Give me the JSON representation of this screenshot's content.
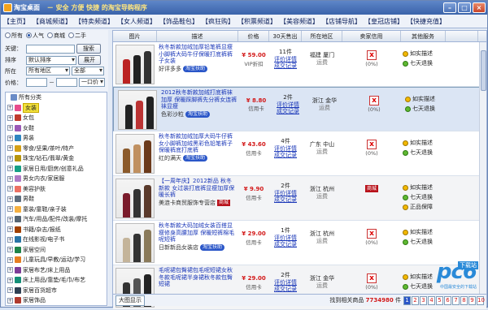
{
  "window": {
    "title": "淘宝桌面",
    "subtitle": "－ 安全 方便 快捷 的淘宝导购程序"
  },
  "menu": [
    "【主页】",
    "【商城频道】",
    "【特卖频道】",
    "【女人频道】",
    "【饰品鞋包】",
    "【疯狂购】",
    "【积票频道】",
    "【美容频道】",
    "【店铺导航】",
    "【皇冠店铺】",
    "【快捷充值】"
  ],
  "filters": {
    "type_options": [
      "所有",
      "人气",
      "商城",
      "二手"
    ],
    "type_selected": 1,
    "keyword_label": "关键：",
    "keyword_value": "",
    "search_button": "搜索",
    "sort_label": "排序",
    "sort_value": "默认排序",
    "expand_button": "展开",
    "region_label": "所在",
    "region_value": "所有地区",
    "region2_value": "全部",
    "price_label": "价格：",
    "price_sep": "－",
    "price_unit": "一口价"
  },
  "tree": {
    "root": "所有分类",
    "items": [
      {
        "label": "女装",
        "selected": true,
        "color": "#e74c8b"
      },
      {
        "label": "女包",
        "color": "#c0392b"
      },
      {
        "label": "女鞋",
        "color": "#9b59b6"
      },
      {
        "label": "男装",
        "color": "#2e86c1"
      },
      {
        "label": "零食/坚果/茶叶/特产",
        "color": "#d4a017"
      },
      {
        "label": "珠宝/钻石/翡翠/黄金",
        "color": "#b7950b"
      },
      {
        "label": "家居日用/厨房/创意礼品",
        "color": "#16a085"
      },
      {
        "label": "男女内衣/家居服",
        "color": "#af7ac5"
      },
      {
        "label": "美容护肤",
        "color": "#ec7063"
      },
      {
        "label": "男鞋",
        "color": "#5d6d7e"
      },
      {
        "label": "童装/童鞋/亲子装",
        "color": "#f5b041"
      },
      {
        "label": "汽车/用品/配件/改装/摩托",
        "color": "#566573"
      },
      {
        "label": "书籍/杂志/报纸",
        "color": "#a04000"
      },
      {
        "label": "在线影视/电子书",
        "color": "#2874a6"
      },
      {
        "label": "家居空间",
        "color": "#1e8449"
      },
      {
        "label": "儿童玩具/早教/运动/学习",
        "color": "#e67e22"
      },
      {
        "label": "家居布艺/床上用品",
        "color": "#7d3c98"
      },
      {
        "label": "床上用品/靠垫/毛巾/布艺",
        "color": "#148f77"
      },
      {
        "label": "家居百货超市",
        "color": "#2e4053"
      },
      {
        "label": "家居饰品",
        "color": "#b03a2e"
      }
    ]
  },
  "table": {
    "headers": [
      "图片",
      "描述",
      "价格",
      "30天售出",
      "所在地区",
      "卖家信用",
      "其他服务"
    ],
    "rows": [
      {
        "desc": "秋冬新款加绒加厚铅笔裤显瘦小脚裤大码牛仔保暖打底裤裤子女装",
        "seller": "好评多多",
        "coupon": "淘宝扶助",
        "price": "¥ 59.00",
        "pay": "VIP折扣",
        "sales": "11件",
        "review": "评价详情",
        "record": "成交记录",
        "province": "福建",
        "city": "厦门",
        "fee": "运费",
        "credit": "x",
        "pct": "(0%)",
        "svc1": "如实描述",
        "svc2": "七天退换",
        "colors": [
          "#b22",
          "#222",
          "#333"
        ]
      },
      {
        "desc": "2012秋冬新款加绒打底裤袜 加厚 保暖踩脚裤先分裤女连裤袜显瘦",
        "seller": "色彩沙粒",
        "coupon": "淘宝扶助",
        "price": "¥ 8.80",
        "pay": "信用卡",
        "sales": "2件",
        "review": "评价详情",
        "record": "成交记录",
        "province": "浙江",
        "city": "金华",
        "fee": "运费",
        "credit": "x",
        "pct": "(0%)",
        "svc1": "如实描述",
        "svc2": "七天退换",
        "colors": [
          "#222",
          "#b33",
          "#222"
        ]
      },
      {
        "desc": "秋冬新款加绒加厚大码牛仔裤女小脚裤加绒黑彩色铅笔裤子保暖裤底打底裤",
        "seller": "红的满天",
        "coupon": "淘宝扶助",
        "price": "¥ 43.60",
        "pay": "信用卡",
        "sales": "4件",
        "review": "评价详情",
        "record": "成交记录",
        "province": "广东",
        "city": "中山",
        "fee": "运费",
        "credit": "x",
        "pct": "(0%)",
        "svc1": "如实描述",
        "svc2": "七天退换",
        "colors": [
          "#8b5a2b",
          "#c09060",
          "#6b3a1b"
        ]
      },
      {
        "desc": "【一周年庆】2012新品 秋冬新款 女过装打底裤显瘦加厚保暖长裤",
        "seller": "美涟卡商贸服饰专营店",
        "coupon": "商城",
        "price": "¥ 9.90",
        "pay": "信用卡",
        "sales": "2件",
        "review": "评价详情",
        "record": "成交记录",
        "province": "浙江",
        "city": "杭州",
        "fee": "运费",
        "credit": "商城",
        "pct": "",
        "svc1": "如实描述",
        "svc2": "七天退换",
        "svc3": "正品保障",
        "colors": [
          "#7a1b2b",
          "#333",
          "#5a3a2b"
        ]
      },
      {
        "desc": "秋冬新款大码加绒女装百搭显瘦修身高腰加厚 保暖短裤棉毛呢短裤",
        "seller": "日新新品女装店",
        "coupon": "淘宝扶助",
        "price": "¥ 29.00",
        "pay": "信用卡",
        "sales": "1件",
        "review": "评价详情",
        "record": "成交记录",
        "province": "浙江",
        "city": "杭州",
        "fee": "运费",
        "credit": "x",
        "pct": "(0%)",
        "svc1": "如实描述",
        "svc2": "七天退换",
        "colors": [
          "#c4b49a",
          "#333",
          "#8a7a5a"
        ]
      },
      {
        "desc": "毛呢裙包臀裙包毛呢短裙女秋冬款毛呢裙半身裙秋冬款包臀短裙",
        "seller": "",
        "coupon": "",
        "price": "¥ 29.00",
        "pay": "信用卡",
        "sales": "2件",
        "review": "评价详情",
        "record": "成交记录",
        "province": "浙江",
        "city": "金华",
        "fee": "运费",
        "credit": "x",
        "pct": "(0%)",
        "svc1": "如实描述",
        "svc2": "七天退换",
        "colors": [
          "#333",
          "#555",
          "#222"
        ]
      }
    ]
  },
  "footer": {
    "big_image": "大图显示",
    "found_prefix": "找到相关商品",
    "count": "7734980",
    "found_suffix": "件",
    "pages": [
      "1",
      "2",
      "3",
      "4",
      "5",
      "6",
      "7",
      "8",
      "9",
      "10"
    ],
    "current_page": "1"
  },
  "watermark": {
    "brand": "pc6",
    "tag": "下载站",
    "slogan": "中国最安全的下载站"
  }
}
